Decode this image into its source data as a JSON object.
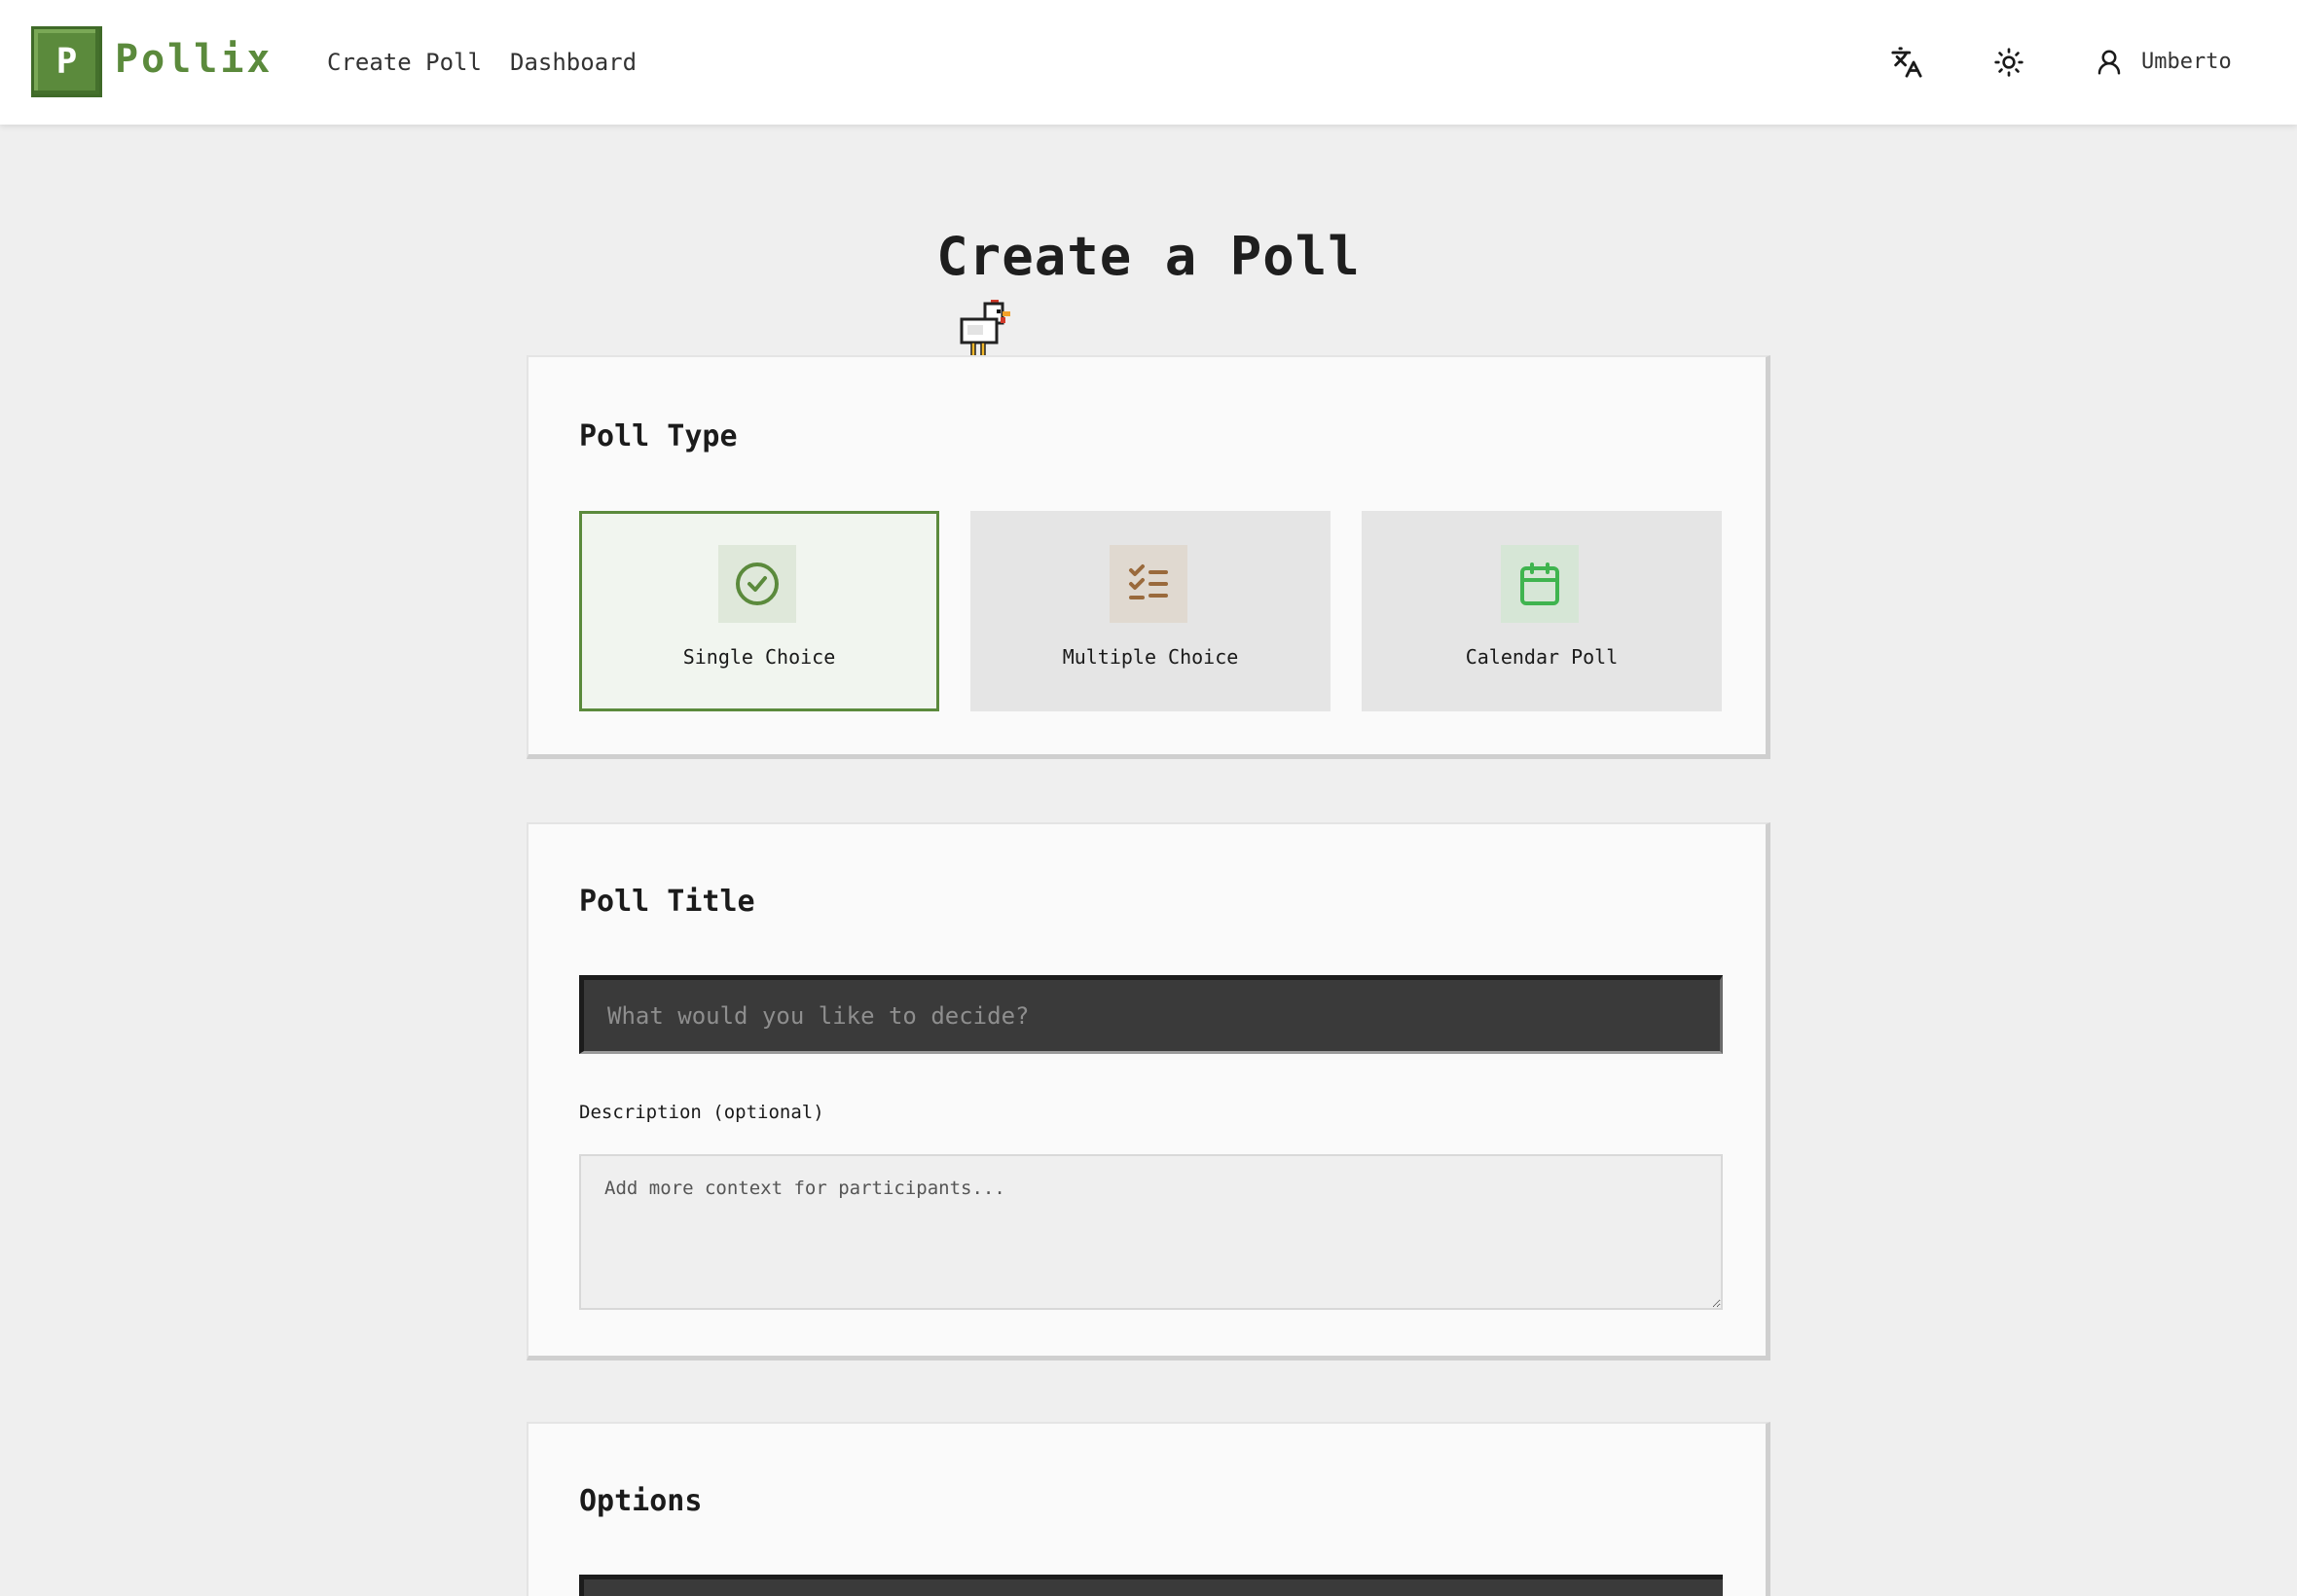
{
  "header": {
    "logo_letter": "P",
    "brand": "Pollix",
    "nav": [
      {
        "label": "Create Poll"
      },
      {
        "label": "Dashboard"
      }
    ],
    "icons": {
      "translate": "translate-icon",
      "theme": "sun-icon",
      "user": "user-icon"
    },
    "user_name": "Umberto"
  },
  "page": {
    "title": "Create a Poll"
  },
  "poll_type": {
    "heading": "Poll Type",
    "options": [
      {
        "label": "Single Choice",
        "icon": "check-circle-icon",
        "selected": true,
        "color": "#5b8a3c"
      },
      {
        "label": "Multiple Choice",
        "icon": "list-check-icon",
        "selected": false,
        "color": "#9a6a3c"
      },
      {
        "label": "Calendar Poll",
        "icon": "calendar-icon",
        "selected": false,
        "color": "#3fb44f"
      }
    ]
  },
  "poll_title": {
    "heading": "Poll Title",
    "input_placeholder": "What would you like to decide?",
    "input_value": "",
    "description_label": "Description (optional)",
    "description_placeholder": "Add more context for participants...",
    "description_value": ""
  },
  "options_section": {
    "heading": "Options"
  },
  "colors": {
    "accent": "#5b8a3c",
    "background": "#efefef",
    "card": "#fafafa",
    "input_dark": "#3a3a3a"
  }
}
